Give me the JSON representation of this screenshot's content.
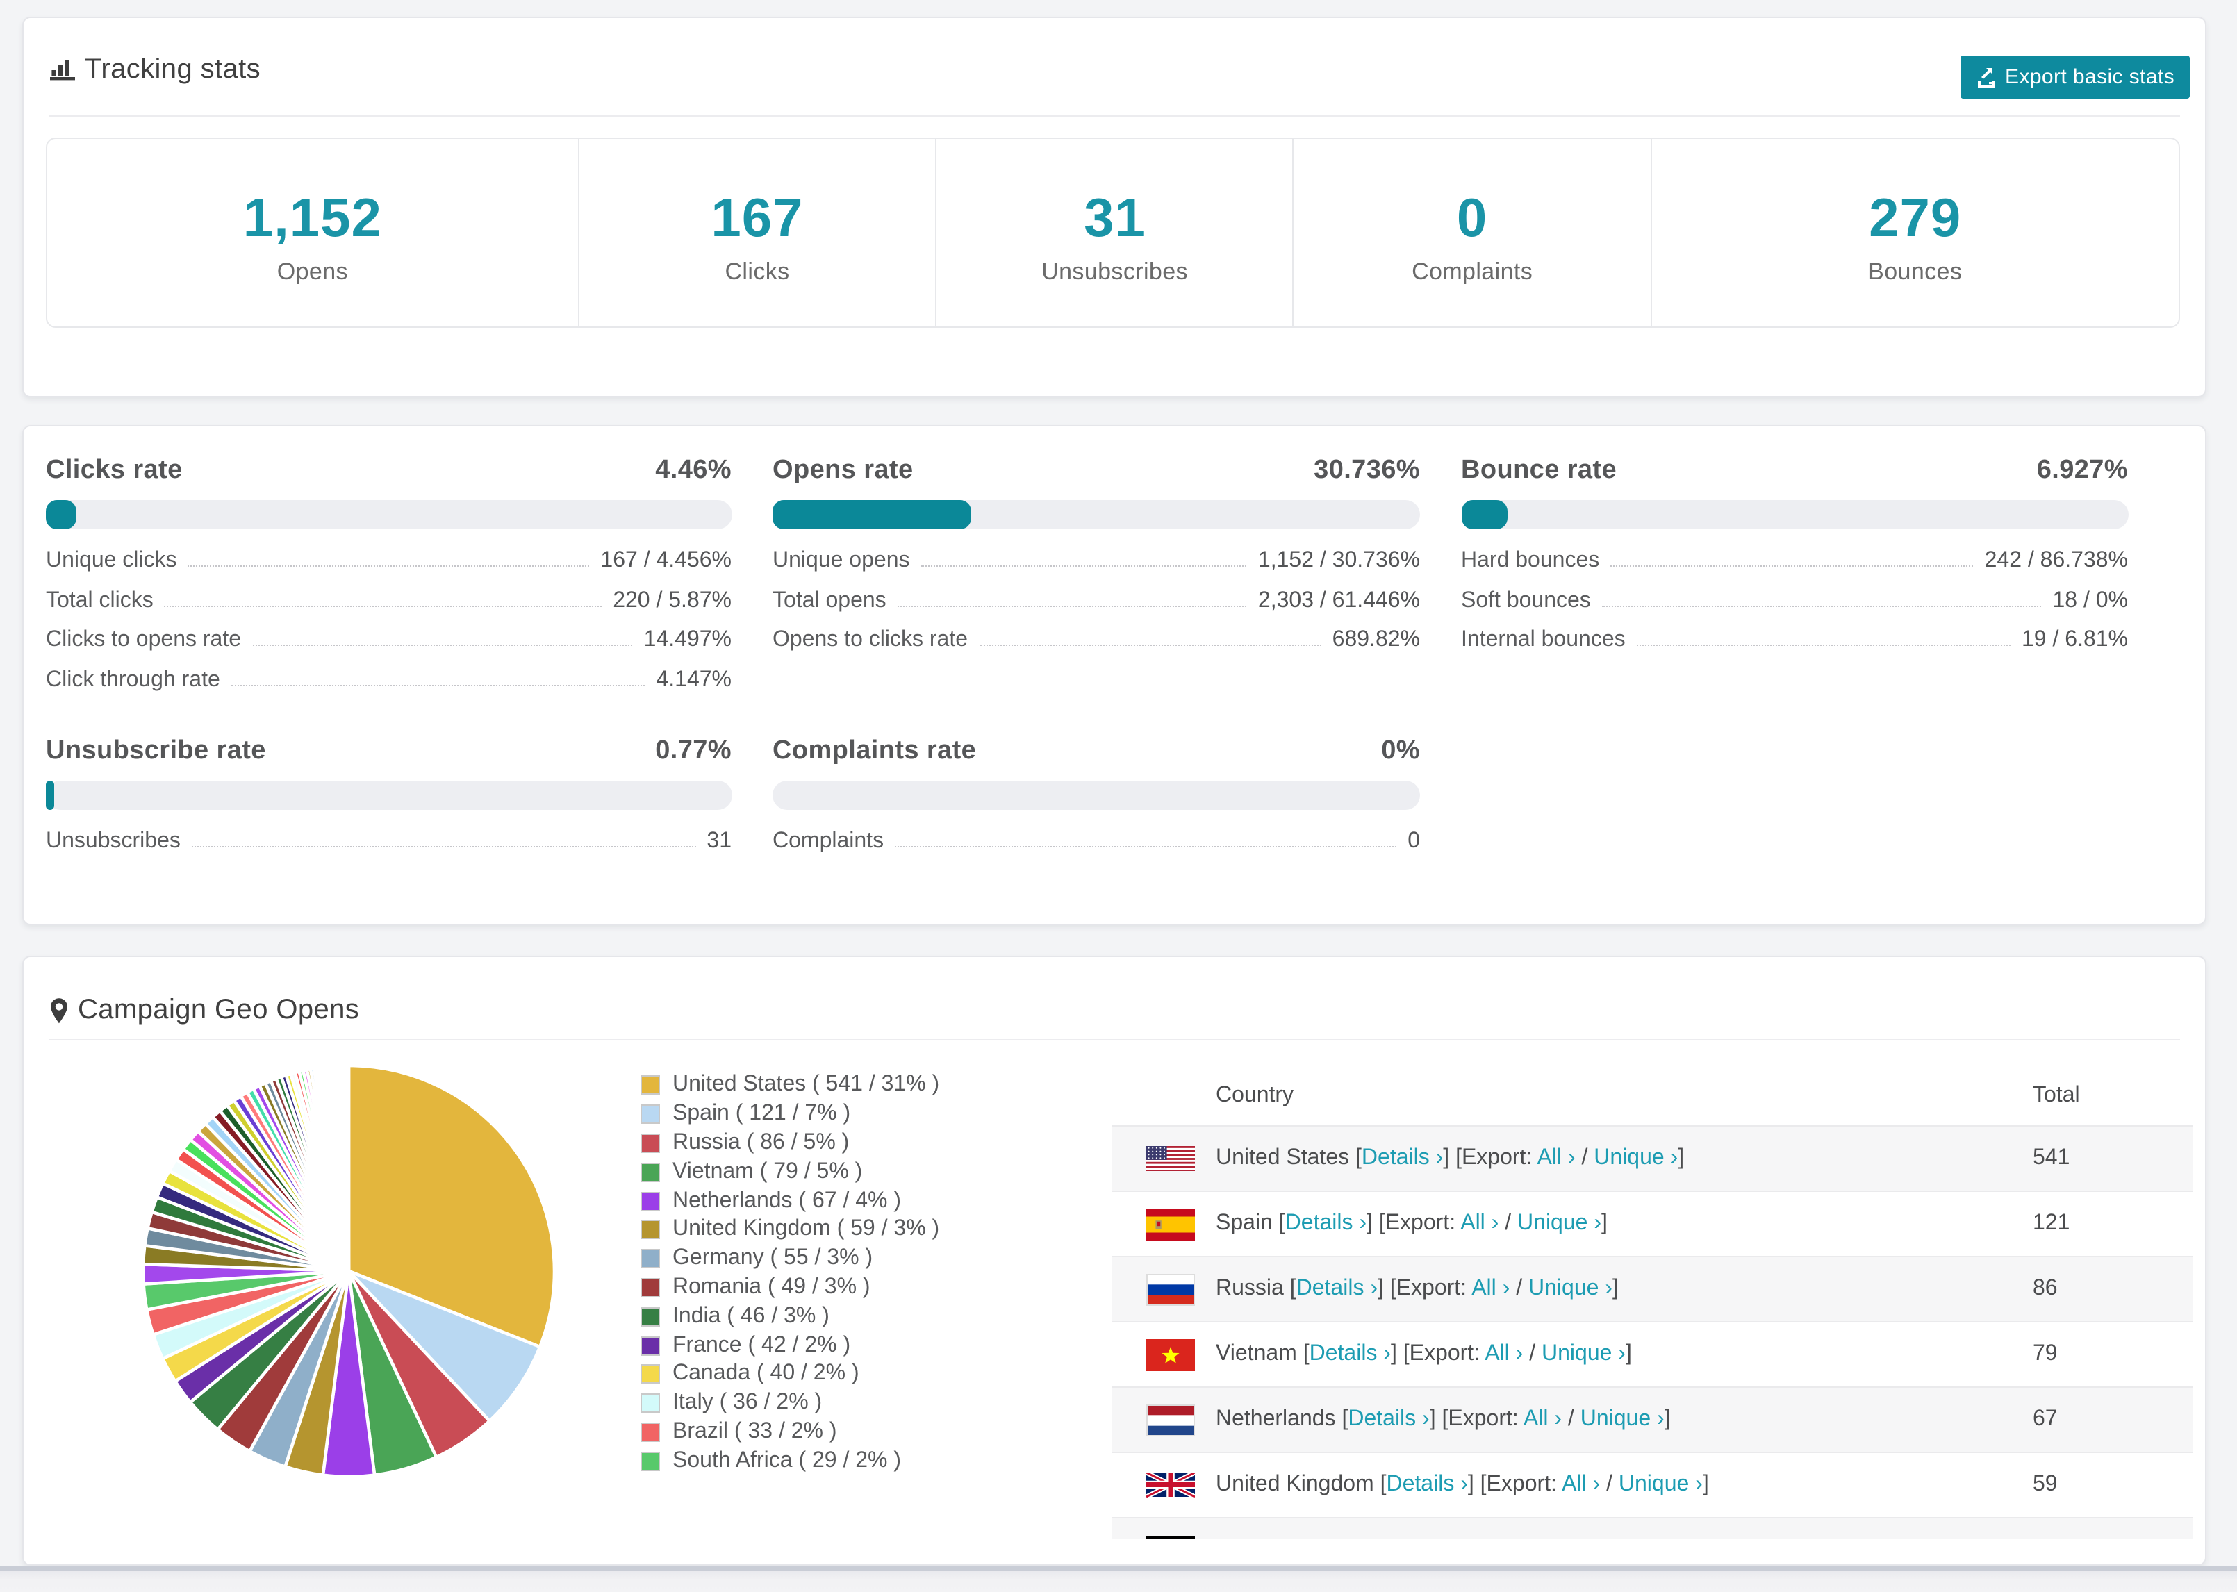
{
  "tracking": {
    "title": "Tracking stats",
    "export_label": "Export basic stats",
    "stats": [
      {
        "value": "1,152",
        "label": "Opens"
      },
      {
        "value": "167",
        "label": "Clicks"
      },
      {
        "value": "31",
        "label": "Unsubscribes"
      },
      {
        "value": "0",
        "label": "Complaints"
      },
      {
        "value": "279",
        "label": "Bounces"
      }
    ]
  },
  "rates": {
    "sections": [
      {
        "title": "Clicks rate",
        "value": "4.46%",
        "bar_pct": 4.46,
        "rows": [
          {
            "label": "Unique clicks",
            "value": "167 / 4.456%"
          },
          {
            "label": "Total clicks",
            "value": "220 / 5.87%"
          },
          {
            "label": "Clicks to opens rate",
            "value": "14.497%"
          },
          {
            "label": "Click through rate",
            "value": "4.147%"
          }
        ]
      },
      {
        "title": "Opens rate",
        "value": "30.736%",
        "bar_pct": 30.736,
        "rows": [
          {
            "label": "Unique opens",
            "value": "1,152 / 30.736%"
          },
          {
            "label": "Total opens",
            "value": "2,303 / 61.446%"
          },
          {
            "label": "Opens to clicks rate",
            "value": "689.82%"
          }
        ]
      },
      {
        "title": "Bounce rate",
        "value": "6.927%",
        "bar_pct": 6.927,
        "rows": [
          {
            "label": "Hard bounces",
            "value": "242 / 86.738%"
          },
          {
            "label": "Soft bounces",
            "value": "18 / 0%"
          },
          {
            "label": "Internal bounces",
            "value": "19 / 6.81%"
          }
        ]
      },
      {
        "title": "Unsubscribe rate",
        "value": "0.77%",
        "bar_pct": 0.77,
        "rows": [
          {
            "label": "Unsubscribes",
            "value": "31"
          }
        ]
      },
      {
        "title": "Complaints rate",
        "value": "0%",
        "bar_pct": 0,
        "rows": [
          {
            "label": "Complaints",
            "value": "0"
          }
        ]
      }
    ]
  },
  "geo": {
    "title": "Campaign Geo Opens",
    "chart_data": {
      "type": "pie",
      "title": "Campaign Geo Opens",
      "legend_position": "right",
      "series": [
        {
          "name": "United States",
          "count": 541,
          "pct": 31,
          "color": "#e3b63d",
          "flag": "us"
        },
        {
          "name": "Spain",
          "count": 121,
          "pct": 7,
          "color": "#b9d8f2",
          "flag": "es"
        },
        {
          "name": "Russia",
          "count": 86,
          "pct": 5,
          "color": "#c94c55",
          "flag": "ru"
        },
        {
          "name": "Vietnam",
          "count": 79,
          "pct": 5,
          "color": "#4aa556",
          "flag": "vn"
        },
        {
          "name": "Netherlands",
          "count": 67,
          "pct": 4,
          "color": "#9b3fe8",
          "flag": "nl"
        },
        {
          "name": "United Kingdom",
          "count": 59,
          "pct": 3,
          "color": "#b5952f",
          "flag": "gb"
        },
        {
          "name": "Germany",
          "count": 55,
          "pct": 3,
          "color": "#8fafc9",
          "flag": "de"
        },
        {
          "name": "Romania",
          "count": 49,
          "pct": 3,
          "color": "#a03b3b"
        },
        {
          "name": "India",
          "count": 46,
          "pct": 3,
          "color": "#367f44"
        },
        {
          "name": "France",
          "count": 42,
          "pct": 2,
          "color": "#6a2fa8"
        },
        {
          "name": "Canada",
          "count": 40,
          "pct": 2,
          "color": "#f4d94a"
        },
        {
          "name": "Italy",
          "count": 36,
          "pct": 2,
          "color": "#d3fafa"
        },
        {
          "name": "Brazil",
          "count": 33,
          "pct": 2,
          "color": "#f16464"
        },
        {
          "name": "South Africa",
          "count": 29,
          "pct": 2,
          "color": "#58c96b"
        }
      ],
      "other_pct": 26,
      "other_palette": [
        "#a348ec",
        "#8a7b24",
        "#6f8b9e",
        "#8f3a39",
        "#2f7a3c",
        "#352a7e",
        "#e8e23d",
        "#f3fdfd",
        "#f2514f",
        "#49e05c",
        "#e24fe2",
        "#caa53d",
        "#a3d4f7",
        "#851c25",
        "#1d5e2a",
        "#cfcf2e",
        "#6a3fd4",
        "#ff7a7a",
        "#44ddaa"
      ]
    },
    "table": {
      "headers": {
        "country": "Country",
        "total": "Total"
      },
      "link_labels": {
        "details": "Details ›",
        "export": "Export:",
        "all": "All ›",
        "unique": "Unique ›"
      }
    }
  }
}
